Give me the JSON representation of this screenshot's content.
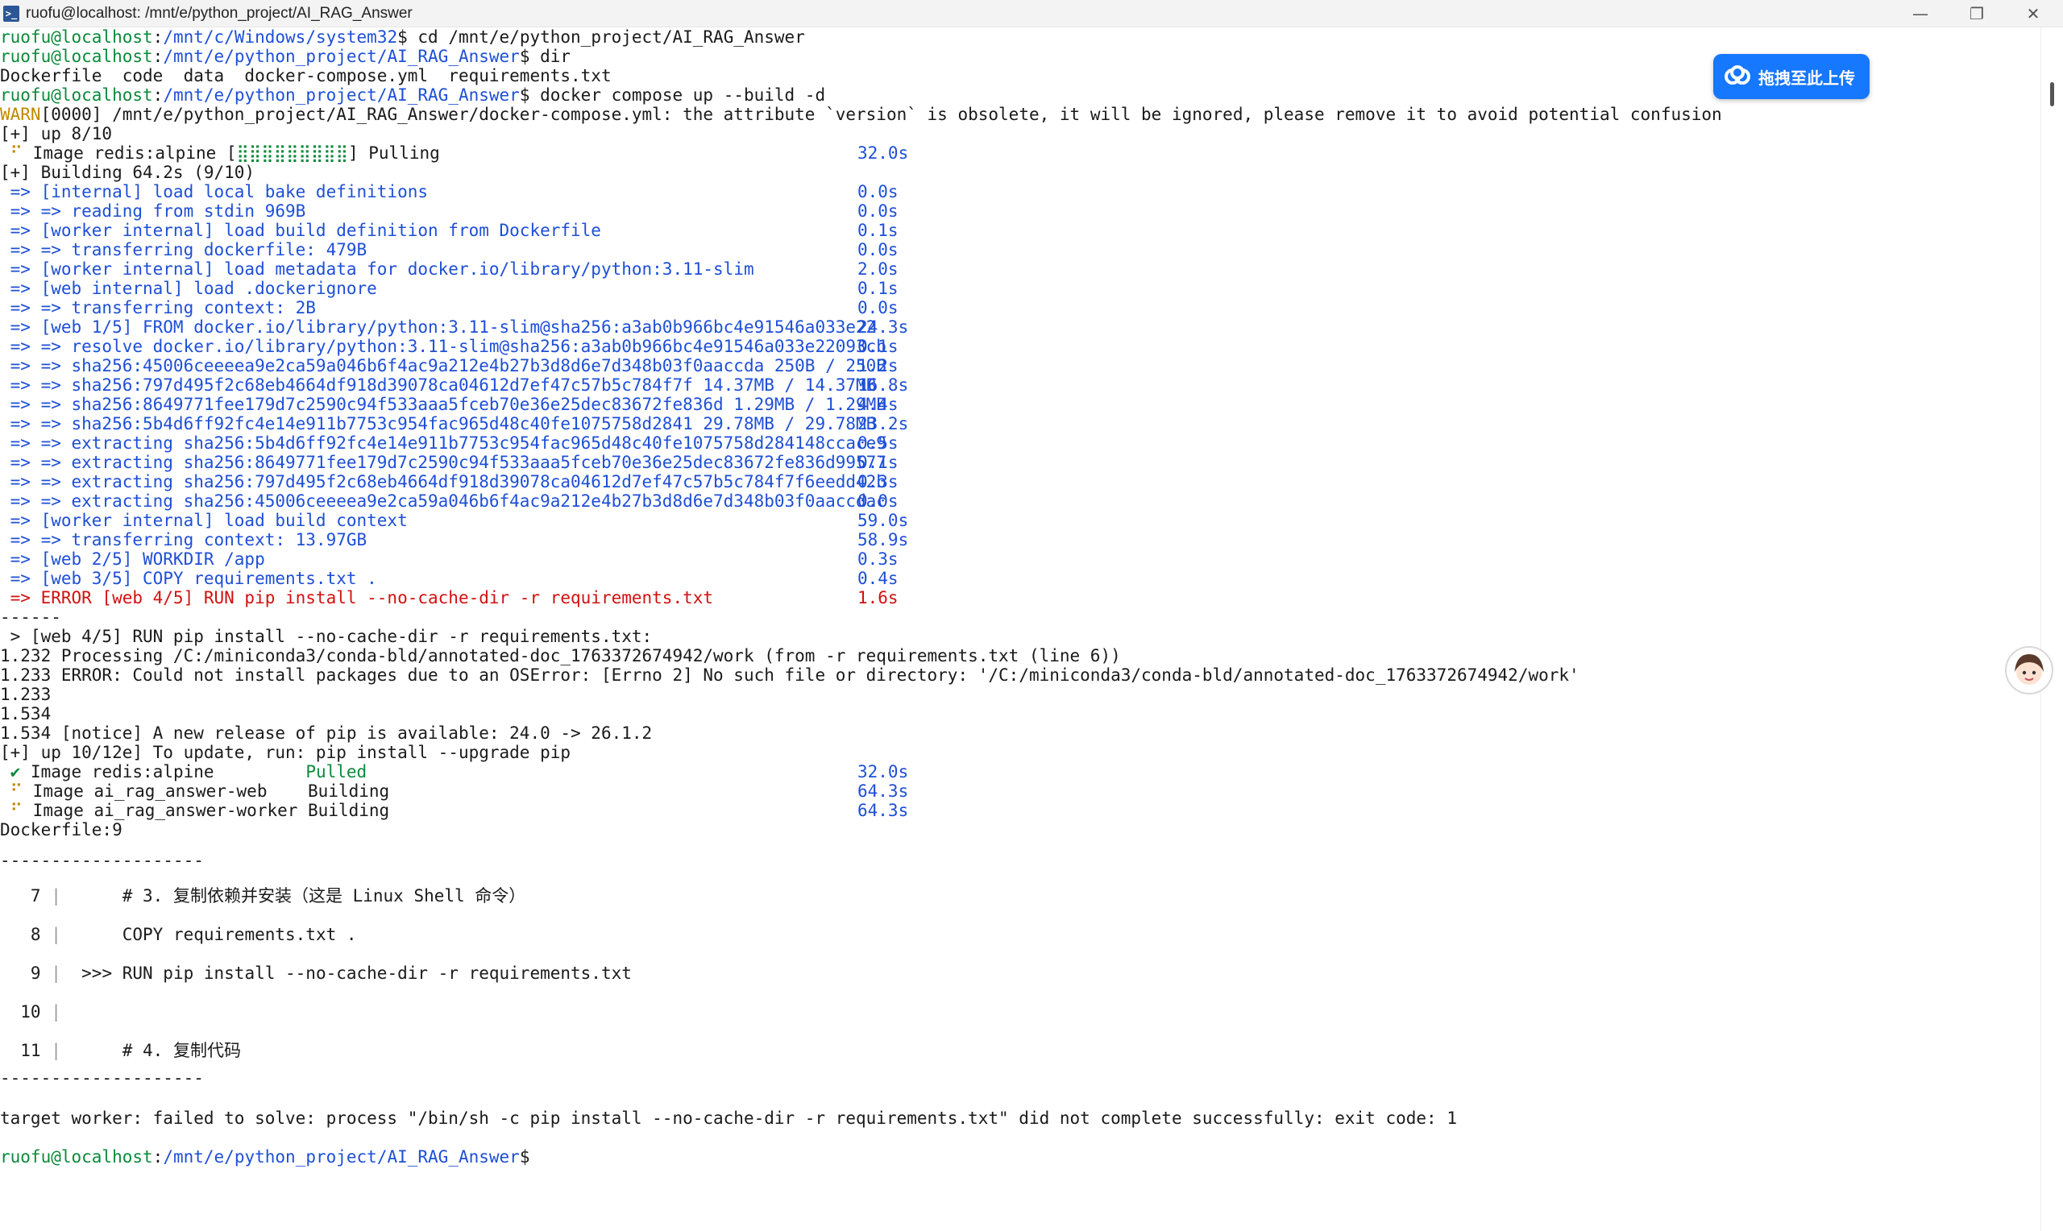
{
  "window": {
    "title": "ruofu@localhost: /mnt/e/python_project/AI_RAG_Answer",
    "icon_text": ">_",
    "minimize": "—",
    "maximize": "❐",
    "close": "✕"
  },
  "upload_badge": {
    "label": "拖拽至此上传"
  },
  "terminal": {
    "lines": [
      [
        {
          "t": "ruofu@localhost",
          "c": "green"
        },
        {
          "t": ":",
          "c": "black"
        },
        {
          "t": "/mnt/c/Windows/system32",
          "c": "blue"
        },
        {
          "t": "$ cd /mnt/e/python_project/AI_RAG_Answer",
          "c": "black"
        }
      ],
      [
        {
          "t": "ruofu@localhost",
          "c": "green"
        },
        {
          "t": ":",
          "c": "black"
        },
        {
          "t": "/mnt/e/python_project/AI_RAG_Answer",
          "c": "blue"
        },
        {
          "t": "$ dir",
          "c": "black"
        }
      ],
      [
        {
          "t": "Dockerfile  code  data  docker-compose.yml  requirements.txt",
          "c": "black"
        }
      ],
      [
        {
          "t": "ruofu@localhost",
          "c": "green"
        },
        {
          "t": ":",
          "c": "black"
        },
        {
          "t": "/mnt/e/python_project/AI_RAG_Answer",
          "c": "blue"
        },
        {
          "t": "$ docker compose up --build -d",
          "c": "black"
        }
      ],
      [
        {
          "t": "WARN",
          "c": "yellow"
        },
        {
          "t": "[0000] /mnt/e/python_project/AI_RAG_Answer/docker-compose.yml: the attribute `version` is obsolete, it will be ignored, please remove it to avoid potential confusion",
          "c": "black"
        }
      ],
      [
        {
          "t": "[+] up 8/10",
          "c": "black"
        }
      ],
      [
        {
          "t": " ⠋ ",
          "c": "yellow"
        },
        {
          "t": "Image redis:alpine [",
          "c": "black"
        },
        {
          "t": "⣿⣿⣿⣿⣿⣿⣿⣿⣿",
          "c": "green"
        },
        {
          "t": "] Pulling",
          "c": "black"
        },
        {
          "time": "32.0s",
          "c": "blue"
        }
      ],
      [
        {
          "t": "[+] Building 64.2s (9/10)",
          "c": "black"
        }
      ],
      [
        {
          "t": " => [internal] load local bake definitions",
          "c": "blue"
        },
        {
          "time": "0.0s",
          "c": "blue"
        }
      ],
      [
        {
          "t": " => => reading from stdin 969B",
          "c": "blue"
        },
        {
          "time": "0.0s",
          "c": "blue"
        }
      ],
      [
        {
          "t": " => [worker internal] load build definition from Dockerfile",
          "c": "blue"
        },
        {
          "time": "0.1s",
          "c": "blue"
        }
      ],
      [
        {
          "t": " => => transferring dockerfile: 479B",
          "c": "blue"
        },
        {
          "time": "0.0s",
          "c": "blue"
        }
      ],
      [
        {
          "t": " => [worker internal] load metadata for docker.io/library/python:3.11-slim",
          "c": "blue"
        },
        {
          "time": "2.0s",
          "c": "blue"
        }
      ],
      [
        {
          "t": " => [web internal] load .dockerignore",
          "c": "blue"
        },
        {
          "time": "0.1s",
          "c": "blue"
        }
      ],
      [
        {
          "t": " => => transferring context: 2B",
          "c": "blue"
        },
        {
          "time": "0.0s",
          "c": "blue"
        }
      ],
      [
        {
          "t": " => [web 1/5] FROM docker.io/library/python:3.11-slim@sha256:a3ab0b966bc4e91546a033e22",
          "c": "blue"
        },
        {
          "time": "24.3s",
          "c": "blue"
        }
      ],
      [
        {
          "t": " => => resolve docker.io/library/python:3.11-slim@sha256:a3ab0b966bc4e91546a033e22093cb",
          "c": "blue"
        },
        {
          "time": "0.1s",
          "c": "blue"
        }
      ],
      [
        {
          "t": " => => sha256:45006ceeeea9e2ca59a046b6f4ac9a212e4b27b3d8d6e7d348b03f0aaccda 250B / 250B",
          "c": "blue"
        },
        {
          "time": "1.2s",
          "c": "blue"
        }
      ],
      [
        {
          "t": " => => sha256:797d495f2c68eb4664df918d39078ca04612d7ef47c57b5c784f7f 14.37MB / 14.37MB",
          "c": "blue"
        },
        {
          "time": "16.8s",
          "c": "blue"
        }
      ],
      [
        {
          "t": " => => sha256:8649771fee179d7c2590c94f533aaa5fceb70e36e25dec83672fe836d 1.29MB / 1.29MB",
          "c": "blue"
        },
        {
          "time": "4.4s",
          "c": "blue"
        }
      ],
      [
        {
          "t": " => => sha256:5b4d6ff92fc4e14e911b7753c954fac965d48c40fe1075758d2841 29.78MB / 29.78MB",
          "c": "blue"
        },
        {
          "time": "23.2s",
          "c": "blue"
        }
      ],
      [
        {
          "t": " => => extracting sha256:5b4d6ff92fc4e14e911b7753c954fac965d48c40fe1075758d284148ccace9",
          "c": "blue"
        },
        {
          "time": "0.5s",
          "c": "blue"
        }
      ],
      [
        {
          "t": " => => extracting sha256:8649771fee179d7c2590c94f533aaa5fceb70e36e25dec83672fe836d99577",
          "c": "blue"
        },
        {
          "time": "0.1s",
          "c": "blue"
        }
      ],
      [
        {
          "t": " => => extracting sha256:797d495f2c68eb4664df918d39078ca04612d7ef47c57b5c784f7f6eedd42b",
          "c": "blue"
        },
        {
          "time": "0.3s",
          "c": "blue"
        }
      ],
      [
        {
          "t": " => => extracting sha256:45006ceeeea9e2ca59a046b6f4ac9a212e4b27b3d8d6e7d348b03f0aaccdac",
          "c": "blue"
        },
        {
          "time": "0.0s",
          "c": "blue"
        }
      ],
      [
        {
          "t": " => [worker internal] load build context",
          "c": "blue"
        },
        {
          "time": "59.0s",
          "c": "blue"
        }
      ],
      [
        {
          "t": " => => transferring context: 13.97GB",
          "c": "blue"
        },
        {
          "time": "58.9s",
          "c": "blue"
        }
      ],
      [
        {
          "t": " => [web 2/5] WORKDIR /app",
          "c": "blue"
        },
        {
          "time": "0.3s",
          "c": "blue"
        }
      ],
      [
        {
          "t": " => [web 3/5] COPY requirements.txt .",
          "c": "blue"
        },
        {
          "time": "0.4s",
          "c": "blue"
        }
      ],
      [
        {
          "t": " => ERROR [web 4/5] RUN pip install --no-cache-dir -r requirements.txt",
          "c": "red"
        },
        {
          "time": "1.6s",
          "c": "red"
        }
      ],
      [
        {
          "t": "------",
          "c": "black"
        }
      ],
      [
        {
          "t": " > [web 4/5] RUN pip install --no-cache-dir -r requirements.txt:",
          "c": "black"
        }
      ],
      [
        {
          "t": "1.232 Processing /C:/miniconda3/conda-bld/annotated-doc_1763372674942/work (from -r requirements.txt (line 6))",
          "c": "black"
        }
      ],
      [
        {
          "t": "1.233 ERROR: Could not install packages due to an OSError: [Errno 2] No such file or directory: '/C:/miniconda3/conda-bld/annotated-doc_1763372674942/work'",
          "c": "black"
        }
      ],
      [
        {
          "t": "1.233",
          "c": "black"
        }
      ],
      [
        {
          "t": "1.534",
          "c": "black"
        }
      ],
      [
        {
          "t": "1.534 [notice] A new release of pip is available: 24.0 -> 26.1.2",
          "c": "black"
        }
      ],
      [
        {
          "t": "[+] up 10/12e] To update, run: pip install --upgrade pip",
          "c": "black"
        }
      ],
      [
        {
          "t": " ✔ ",
          "c": "green"
        },
        {
          "t": "Image redis:alpine         ",
          "c": "black"
        },
        {
          "t": "Pulled",
          "c": "green"
        },
        {
          "time": "32.0s",
          "c": "blue"
        }
      ],
      [
        {
          "t": " ⠋ ",
          "c": "yellow"
        },
        {
          "t": "Image ai_rag_answer-web    Building",
          "c": "black"
        },
        {
          "time": "64.3s",
          "c": "blue"
        }
      ],
      [
        {
          "t": " ⠋ ",
          "c": "yellow"
        },
        {
          "t": "Image ai_rag_answer-worker Building",
          "c": "black"
        },
        {
          "time": "64.3s",
          "c": "blue"
        }
      ],
      [
        {
          "t": "Dockerfile:9",
          "c": "black"
        }
      ]
    ],
    "separator_1": "--------------------",
    "source_lines": [
      {
        "num": "   7",
        "bar": " | ",
        "text": "     # 3. 复制依赖并安装（这是 Linux Shell 命令）"
      },
      {
        "num": "   8",
        "bar": " | ",
        "text": "     COPY requirements.txt ."
      },
      {
        "num": "   9",
        "bar": " | ",
        "text": " >>> RUN pip install --no-cache-dir -r requirements.txt"
      },
      {
        "num": "  10",
        "bar": " | ",
        "text": ""
      },
      {
        "num": "  11",
        "bar": " | ",
        "text": "     # 4. 复制代码"
      }
    ],
    "separator_2": "--------------------",
    "error_line": "target worker: failed to solve: process \"/bin/sh -c pip install --no-cache-dir -r requirements.txt\" did not complete successfully: exit code: 1",
    "prompt": [
      {
        "t": "ruofu@localhost",
        "c": "green"
      },
      {
        "t": ":",
        "c": "black"
      },
      {
        "t": "/mnt/e/python_project/AI_RAG_Answer",
        "c": "blue"
      },
      {
        "t": "$",
        "c": "black"
      }
    ]
  }
}
